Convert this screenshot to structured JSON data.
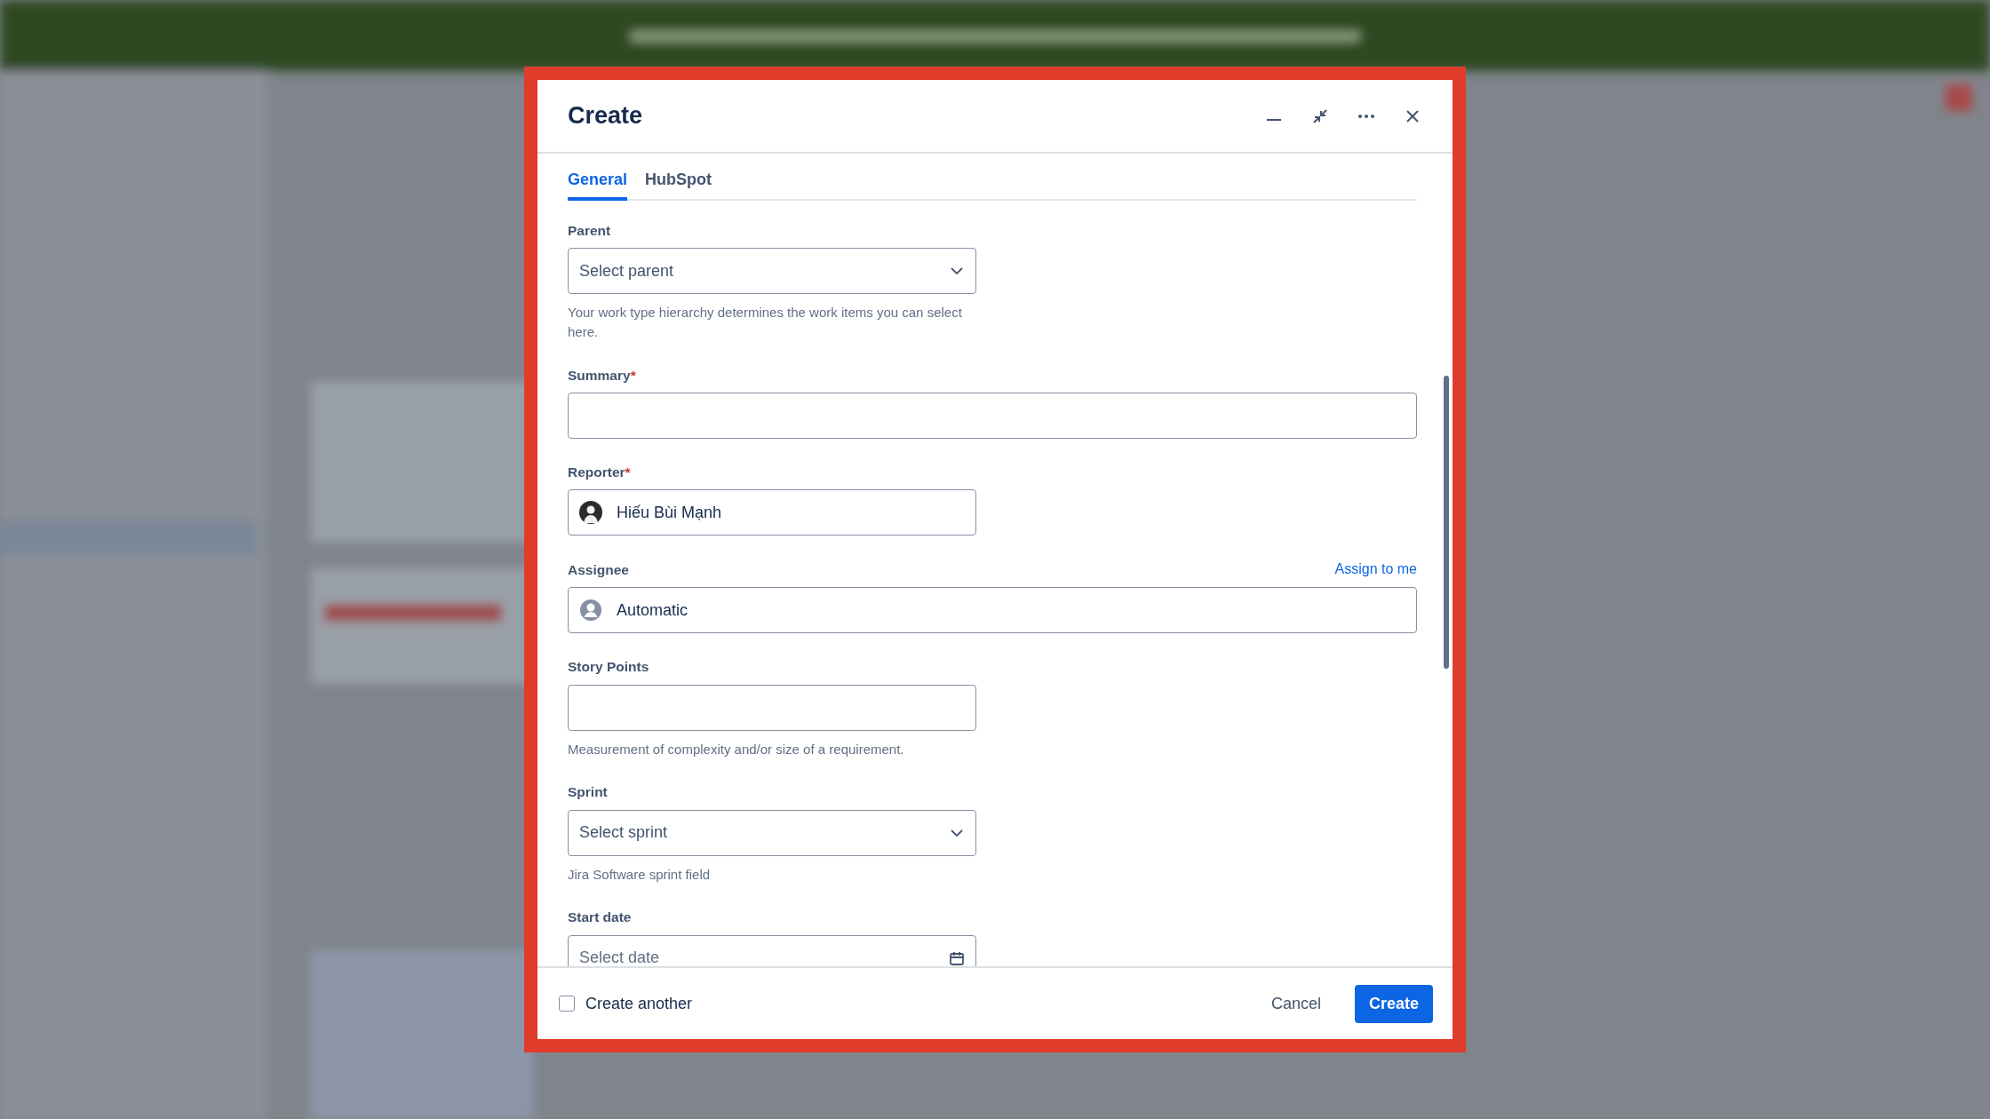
{
  "dialog": {
    "title": "Create",
    "tabs": [
      {
        "label": "General",
        "selected": true
      },
      {
        "label": "HubSpot",
        "selected": false
      }
    ],
    "fields": [
      {
        "kind": "select",
        "label": "Parent",
        "placeholder": "Select parent",
        "help": "Your work type hierarchy determines the work items you can select here."
      },
      {
        "kind": "text",
        "label": "Summary",
        "required_mark": "*"
      },
      {
        "kind": "user",
        "label": "Reporter",
        "required_mark": "*",
        "value": "Hiếu Bùi Mạnh"
      },
      {
        "kind": "auto-user",
        "label": "Assignee",
        "value": "Automatic",
        "action": "Assign to me"
      },
      {
        "kind": "number",
        "label": "Story Points",
        "help": "Measurement of complexity and/or size of a requirement."
      },
      {
        "kind": "select",
        "label": "Sprint",
        "placeholder": "Select sprint",
        "help": "Jira Software sprint field"
      },
      {
        "kind": "date",
        "label": "Start date",
        "placeholder": "Select date"
      }
    ],
    "create_another": {
      "label": "Create another",
      "checked": false
    },
    "buttons": [
      {
        "label": "Cancel",
        "kind": "subtle"
      },
      {
        "label": "Create",
        "kind": "primary"
      }
    ]
  }
}
